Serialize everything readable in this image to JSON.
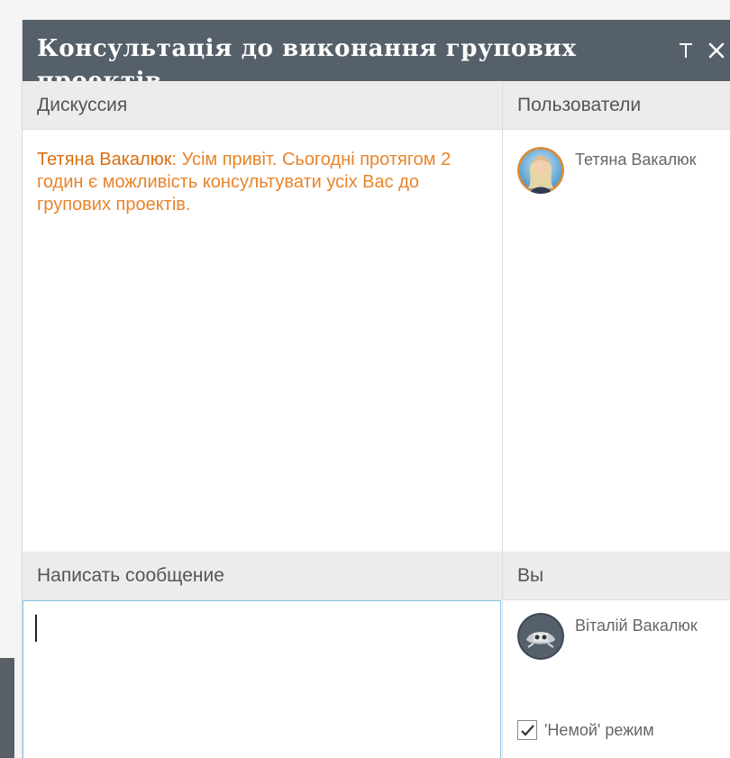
{
  "window": {
    "title": "Консультація до виконання групових проектів",
    "pin_icon": "pin-icon",
    "close_icon": "close-icon"
  },
  "discussion": {
    "header": "Дискуссия",
    "messages": [
      {
        "author": "Тетяна Вакалюк",
        "text": ": Усім привіт. Сьогодні протягом 2 годин є можливість консультувати усіх Вас до групових проектів."
      }
    ]
  },
  "users_panel": {
    "header": "Пользователи",
    "users": [
      {
        "name": "Тетяна Вакалюк",
        "avatar": "avatar-photo"
      }
    ]
  },
  "compose": {
    "header": "Написать сообщение",
    "value": ""
  },
  "you_panel": {
    "header": "Вы",
    "name": "Віталій Вакалюк",
    "avatar": "avatar-photo",
    "mute_label": "'Немой' режим",
    "mute_checked": true
  },
  "colors": {
    "titlebar": "#56606a",
    "message": "#e8842a",
    "header_bg": "#ececec",
    "input_border": "#8bc4ea"
  }
}
